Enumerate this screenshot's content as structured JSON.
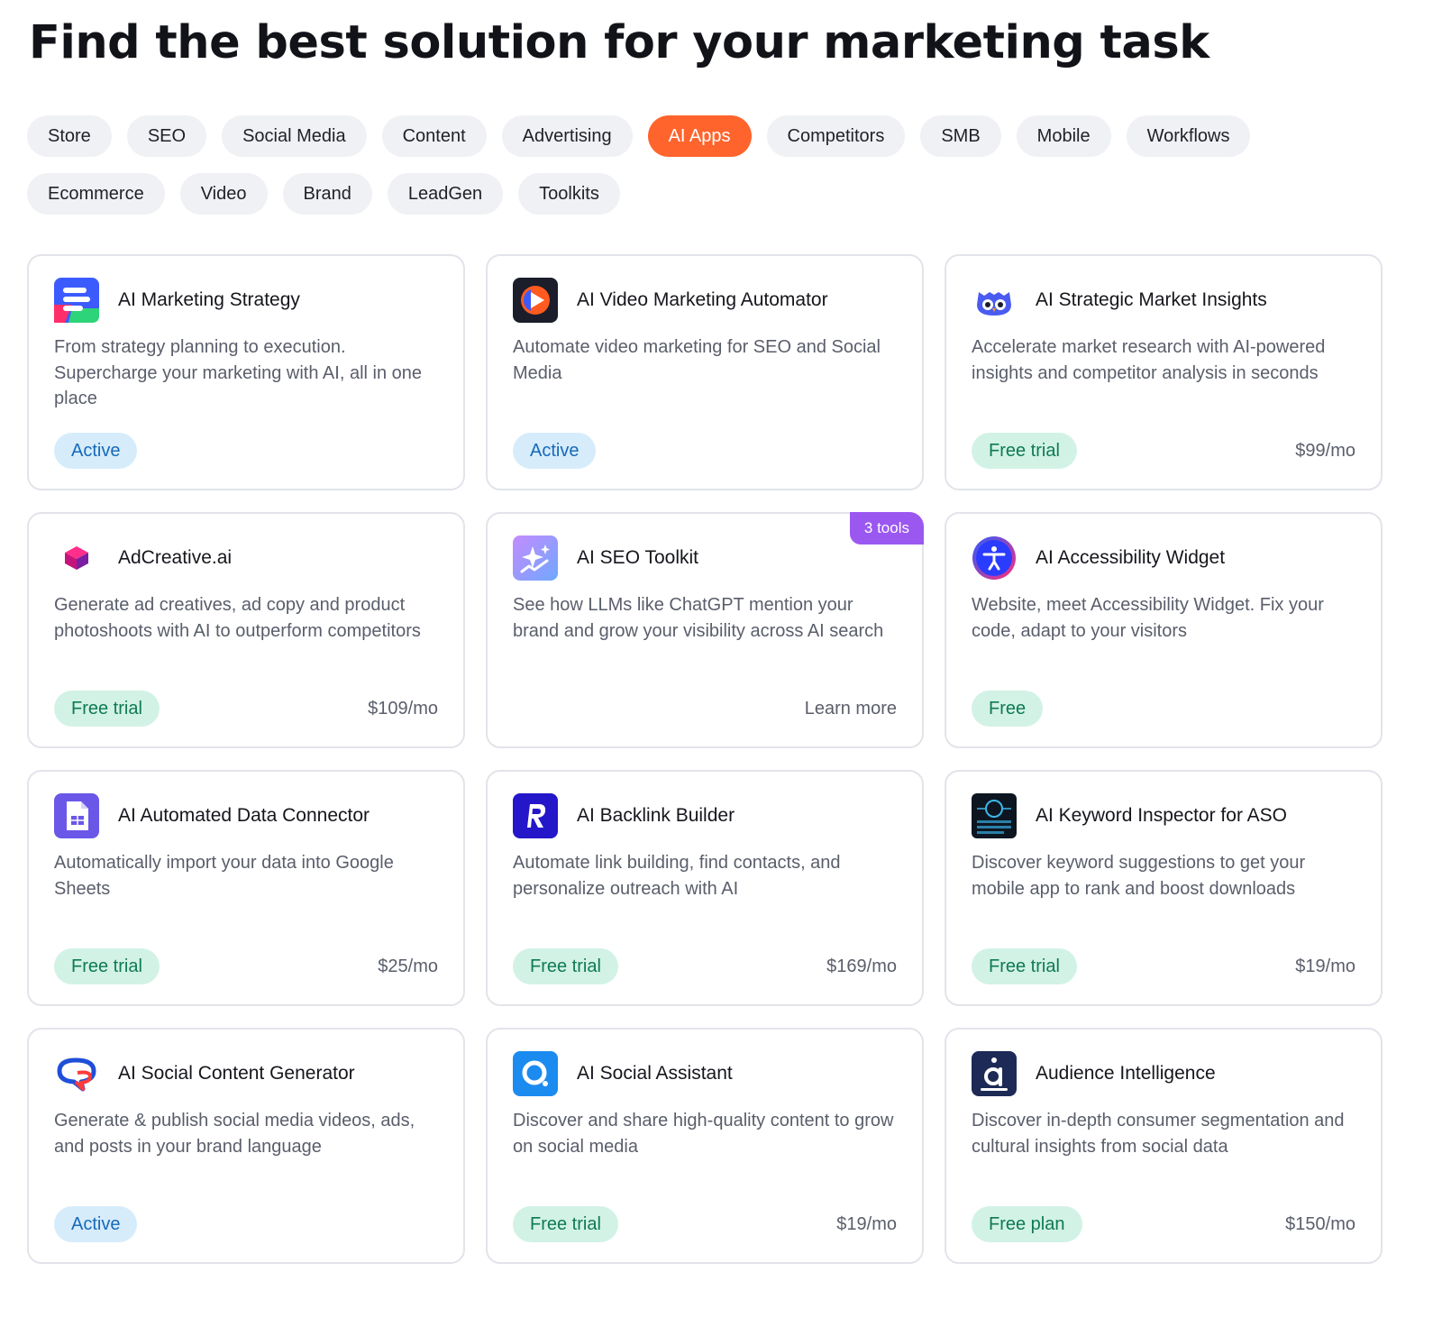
{
  "page": {
    "title": "Find the best solution for your marketing task"
  },
  "categories": {
    "row1": [
      "Store",
      "SEO",
      "Social Media",
      "Content",
      "Advertising",
      "AI Apps",
      "Competitors",
      "SMB",
      "Mobile",
      "Workflows"
    ],
    "row2": [
      "Ecommerce",
      "Video",
      "Brand",
      "LeadGen",
      "Toolkits"
    ],
    "selected": "AI Apps"
  },
  "cards": [
    {
      "title": "AI Marketing Strategy",
      "description": "From strategy planning to execution. Supercharge your marketing with AI, all in one place",
      "badge": "Active",
      "icon": "ai-marketing-strategy-logo"
    },
    {
      "title": "AI Video Marketing Automator",
      "description": "Automate video marketing for SEO and Social Media",
      "badge": "Active",
      "icon": "video-play-logo"
    },
    {
      "title": "AI Strategic Market Insights",
      "description": "Accelerate market research with AI-powered insights and competitor analysis in seconds",
      "badge": "Free trial",
      "price": "$99/mo",
      "icon": "owl-logo"
    },
    {
      "title": "AdCreative.ai",
      "description": "Generate ad creatives, ad copy and product photoshoots with AI to outperform competitors",
      "badge": "Free trial",
      "price": "$109/mo",
      "icon": "adcreative-cube-logo"
    },
    {
      "title": "AI SEO Toolkit",
      "description": "See how LLMs like ChatGPT mention your brand and grow your visibility across AI search",
      "link": "Learn more",
      "tag": "3 tools",
      "icon": "sparkles-logo"
    },
    {
      "title": "AI Accessibility Widget",
      "description": "Website, meet Accessibility Widget. Fix your code, adapt to your visitors",
      "badge": "Free",
      "icon": "accessibility-logo"
    },
    {
      "title": "AI Automated Data Connector",
      "description": "Automatically import your data into Google Sheets",
      "badge": "Free trial",
      "price": "$25/mo",
      "icon": "sheets-logo"
    },
    {
      "title": "AI Backlink Builder",
      "description": "Automate link building, find contacts, and personalize outreach with AI",
      "badge": "Free trial",
      "price": "$169/mo",
      "icon": "r-letter-logo"
    },
    {
      "title": "AI Keyword Inspector for ASO",
      "description": "Discover keyword suggestions to get your mobile app to rank and boost downloads",
      "badge": "Free trial",
      "price": "$19/mo",
      "icon": "keyword-inspector-logo"
    },
    {
      "title": "AI Social Content Generator",
      "description": "Generate & publish social media videos, ads, and posts in your brand language",
      "badge": "Active",
      "icon": "speech-bubble-logo"
    },
    {
      "title": "AI Social Assistant",
      "description": "Discover and share high-quality content to grow on social media",
      "badge": "Free trial",
      "price": "$19/mo",
      "icon": "social-assistant-logo"
    },
    {
      "title": "Audience Intelligence",
      "description": "Discover in-depth consumer segmentation and cultural insights from social data",
      "badge": "Free plan",
      "price": "$150/mo",
      "icon": "audience-a-logo"
    }
  ],
  "colors": {
    "accent": "#ff642d",
    "active_badge_bg": "#d6ecfb",
    "active_badge_text": "#1769b8",
    "trial_badge_bg": "#d2f2e6",
    "trial_badge_text": "#0e7a52",
    "tools_tag": "#9b58f0"
  }
}
